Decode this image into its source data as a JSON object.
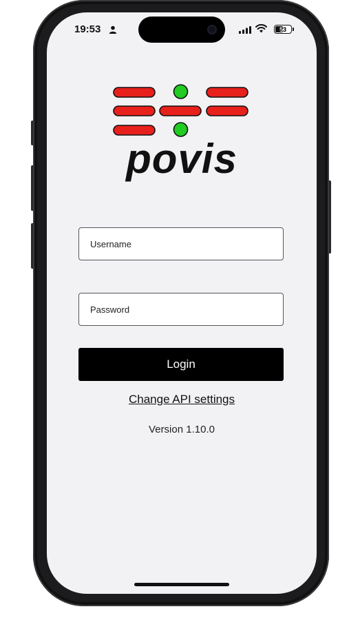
{
  "status_bar": {
    "time": "19:53",
    "battery_level": "53",
    "icons": [
      "person-icon",
      "signal-icon",
      "wifi-icon",
      "battery-icon"
    ]
  },
  "logo": {
    "wordmark": "povis",
    "colors": {
      "red": "#e8201c",
      "green": "#22cc22",
      "outline": "#111111"
    }
  },
  "login_form": {
    "username_placeholder": "Username",
    "password_placeholder": "Password",
    "username_value": "",
    "password_value": "",
    "login_label": "Login"
  },
  "api_settings_link": "Change API settings",
  "version_label": "Version 1.10.0",
  "colors": {
    "screen_bg": "#f2f2f5",
    "button_bg": "#000000",
    "button_text": "#ffffff",
    "frame": "#1c1c1e"
  }
}
